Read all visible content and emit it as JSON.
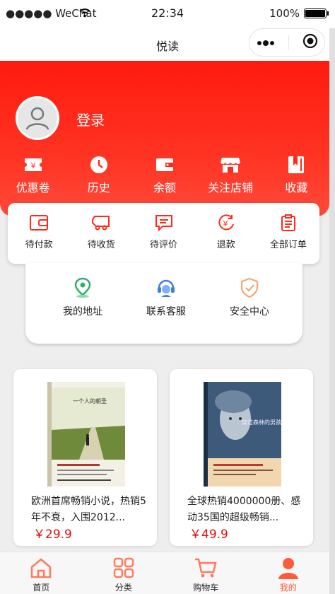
{
  "status_bar": {
    "carrier": "●●●●● WeChat",
    "time": "22:34",
    "battery": "100%",
    "battery_level": 1.0
  },
  "nav": {
    "title": "悦读"
  },
  "profile": {
    "login_label": "登录"
  },
  "quick_links": [
    {
      "label": "优惠卷",
      "icon": "coupon-icon"
    },
    {
      "label": "历史",
      "icon": "clock-icon"
    },
    {
      "label": "余额",
      "icon": "wallet-icon"
    },
    {
      "label": "关注店铺",
      "icon": "store-icon"
    },
    {
      "label": "收藏",
      "icon": "bookmark-icon"
    }
  ],
  "orders": [
    {
      "label": "待付款",
      "icon": "wallet-outline-icon"
    },
    {
      "label": "待收货",
      "icon": "truck-icon"
    },
    {
      "label": "待评价",
      "icon": "comment-icon"
    },
    {
      "label": "退款",
      "icon": "refund-icon"
    },
    {
      "label": "全部订单",
      "icon": "clipboard-icon"
    }
  ],
  "services": [
    {
      "label": "我的地址",
      "icon": "location-icon"
    },
    {
      "label": "联系客服",
      "icon": "headset-icon"
    },
    {
      "label": "安全中心",
      "icon": "shield-icon"
    }
  ],
  "products": [
    {
      "title": "欧洲首席畅销小说，热销5年不衰，入围2012...",
      "price": "￥29.9",
      "cover_title": "一个人的朝圣",
      "cover_colors": {
        "sky": "#dfe4c8",
        "ground": "#6f8a3a",
        "road": "#d8d2b4"
      }
    },
    {
      "title": "全球热销4000000册、感动35国的超级畅销...",
      "price": "￥49.9",
      "cover_title": "穿过森林的男孩",
      "cover_colors": {
        "sky": "#3d5a7a",
        "ground": "#1f3550",
        "band": "#f2d6b0"
      }
    }
  ],
  "tabbar": [
    {
      "label": "首页",
      "icon": "home-icon",
      "active": false
    },
    {
      "label": "分类",
      "icon": "grid-icon",
      "active": false
    },
    {
      "label": "购物车",
      "icon": "cart-icon",
      "active": false
    },
    {
      "label": "我的",
      "icon": "user-icon",
      "active": true
    }
  ],
  "colors": {
    "accent": "#ff1a0f",
    "price": "#e01010",
    "tab_icon": "#ff7a5c"
  }
}
